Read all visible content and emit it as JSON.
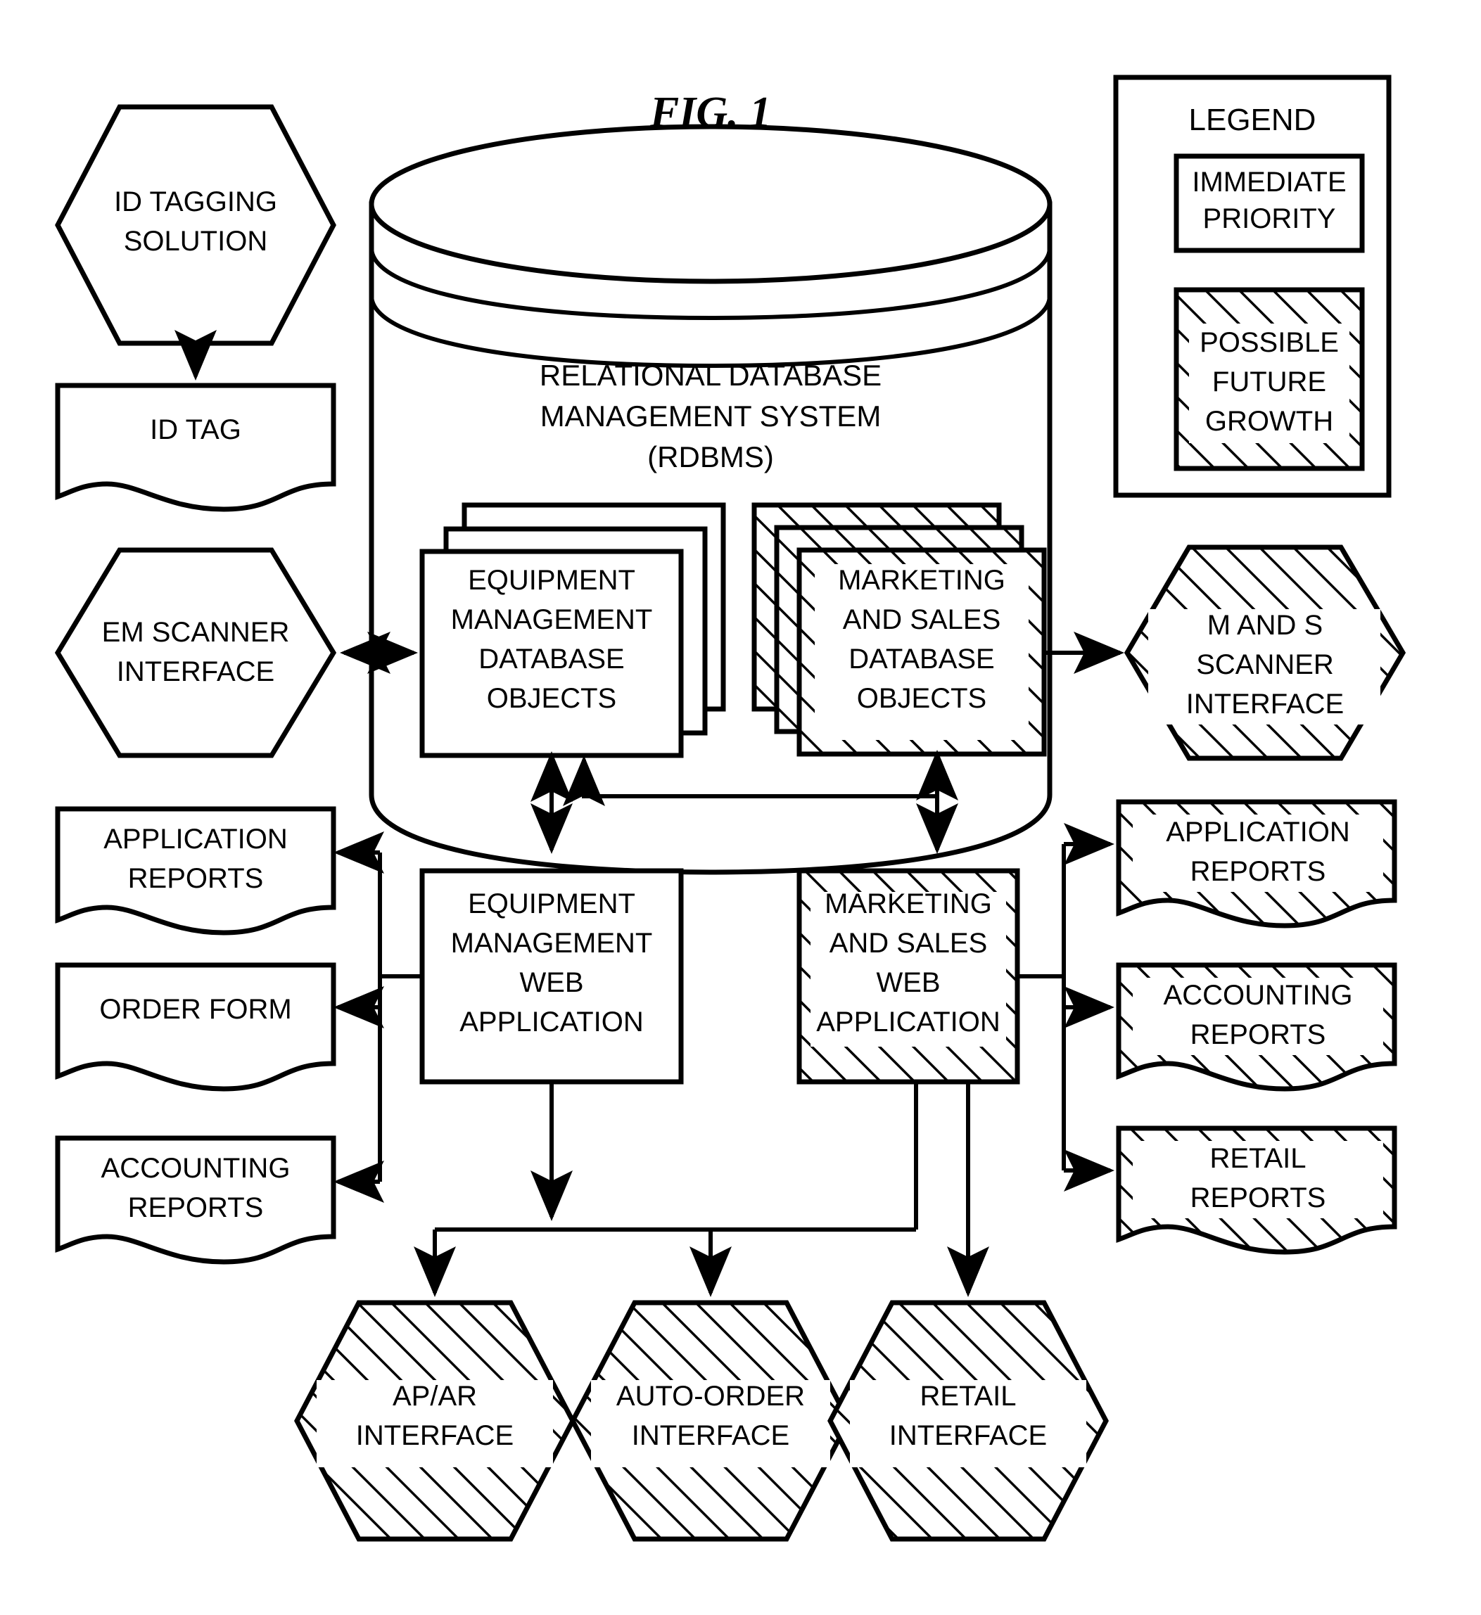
{
  "figure": {
    "title": "FIG. 1",
    "domain": "patent-block-diagram"
  },
  "legend": {
    "title": "LEGEND",
    "items": [
      {
        "label_line1": "IMMEDIATE",
        "label_line2": "PRIORITY",
        "style": "plain"
      },
      {
        "label_line1": "POSSIBLE",
        "label_line2": "FUTURE",
        "label_line3": "GROWTH",
        "style": "hatched"
      }
    ]
  },
  "nodes": {
    "id_tagging_solution": {
      "l1": "ID TAGGING",
      "l2": "SOLUTION",
      "shape": "hexagon",
      "style": "plain"
    },
    "id_tag": {
      "l1": "ID TAG",
      "shape": "document",
      "style": "plain"
    },
    "em_scanner_interface": {
      "l1": "EM SCANNER",
      "l2": "INTERFACE",
      "shape": "hexagon",
      "style": "plain"
    },
    "rdbms": {
      "l1": "RELATIONAL DATABASE",
      "l2": "MANAGEMENT SYSTEM",
      "l3": "(RDBMS)",
      "shape": "cylinder",
      "style": "plain"
    },
    "em_db_objects": {
      "l1": "EQUIPMENT",
      "l2": "MANAGEMENT",
      "l3": "DATABASE",
      "l4": "OBJECTS",
      "shape": "stacked-box",
      "style": "plain"
    },
    "ms_db_objects": {
      "l1": "MARKETING",
      "l2": "AND SALES",
      "l3": "DATABASE",
      "l4": "OBJECTS",
      "shape": "stacked-box",
      "style": "hatched"
    },
    "ms_scanner_interface": {
      "l1": "M AND S",
      "l2": "SCANNER",
      "l3": "INTERFACE",
      "shape": "hexagon",
      "style": "hatched"
    },
    "em_web_app": {
      "l1": "EQUIPMENT",
      "l2": "MANAGEMENT",
      "l3": "WEB",
      "l4": "APPLICATION",
      "shape": "box",
      "style": "plain"
    },
    "ms_web_app": {
      "l1": "MARKETING",
      "l2": "AND SALES",
      "l3": "WEB",
      "l4": "APPLICATION",
      "shape": "box",
      "style": "hatched"
    },
    "em_application_reports": {
      "l1": "APPLICATION",
      "l2": "REPORTS",
      "shape": "document",
      "style": "plain"
    },
    "order_form": {
      "l1": "ORDER FORM",
      "shape": "document",
      "style": "plain"
    },
    "em_accounting_reports": {
      "l1": "ACCOUNTING",
      "l2": "REPORTS",
      "shape": "document",
      "style": "plain"
    },
    "ms_application_reports": {
      "l1": "APPLICATION",
      "l2": "REPORTS",
      "shape": "document",
      "style": "hatched"
    },
    "ms_accounting_reports": {
      "l1": "ACCOUNTING",
      "l2": "REPORTS",
      "shape": "document",
      "style": "hatched"
    },
    "ms_retail_reports": {
      "l1": "RETAIL",
      "l2": "REPORTS",
      "shape": "document",
      "style": "hatched"
    },
    "apar_interface": {
      "l1": "AP/AR",
      "l2": "INTERFACE",
      "shape": "hexagon",
      "style": "hatched"
    },
    "auto_order_interface": {
      "l1": "AUTO-ORDER",
      "l2": "INTERFACE",
      "shape": "hexagon",
      "style": "hatched"
    },
    "retail_interface": {
      "l1": "RETAIL",
      "l2": "INTERFACE",
      "shape": "hexagon",
      "style": "hatched"
    }
  },
  "colors": {
    "stroke": "#000000",
    "background": "#ffffff"
  }
}
